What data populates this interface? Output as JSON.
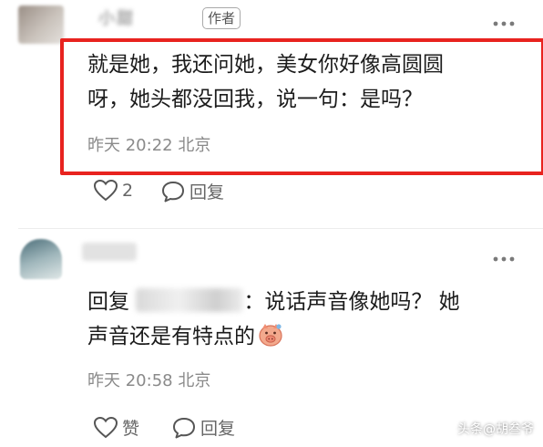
{
  "comment1": {
    "username": "小甜",
    "author_tag": "作者",
    "more_icon": "more-horizontal-icon",
    "text_line1": "就是她，我还问她，美女你好像高圆圆",
    "text_line2": "呀，她头都没回我，说一句：是吗？",
    "timestamp": "昨天 20:22 北京",
    "like_icon": "heart-outline-icon",
    "like_count": "2",
    "reply_icon": "speech-bubble-icon",
    "reply_label": "回复",
    "highlight_color": "#e8231f"
  },
  "comment2": {
    "username": "",
    "more_icon": "more-horizontal-icon",
    "reply_prefix": "回复",
    "mention": "",
    "text_line1_rest": "：说话声音像她吗？ 她",
    "text_line2": "声音还是有特点的",
    "emoji_icon": "pig-face-emoji-icon",
    "timestamp": "昨天 20:58 北京",
    "like_icon": "heart-outline-icon",
    "like_label": "赞",
    "reply_icon": "speech-bubble-icon",
    "reply_label": "回复"
  },
  "watermark": {
    "platform": "头条",
    "handle": "@胡叁爷"
  }
}
